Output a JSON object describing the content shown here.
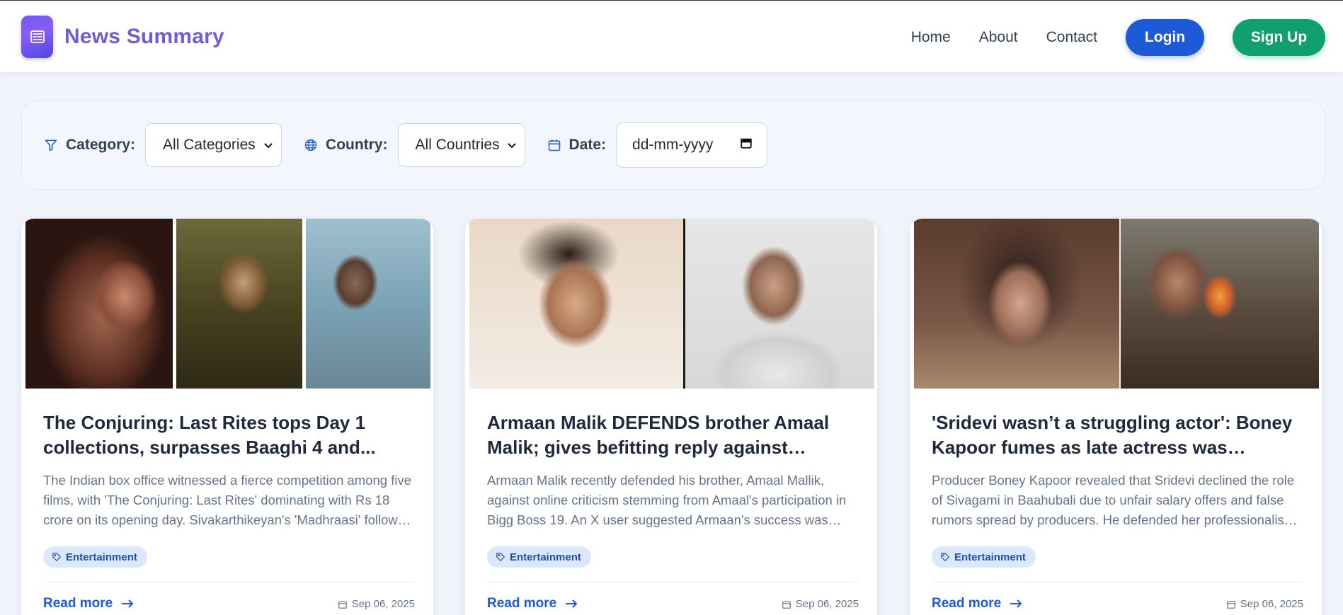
{
  "navbar": {
    "brand_name": "News Summary",
    "brand_icon": "newspaper-icon",
    "links": [
      "Home",
      "About",
      "Contact"
    ],
    "login_label": "Login",
    "signup_label": "Sign Up",
    "colors": {
      "brand": "#6b5fd6",
      "login": "#1d5ad8",
      "signup": "#10a06e"
    }
  },
  "filters": {
    "category_label": "Category:",
    "category_value": "All Categories",
    "country_label": "Country:",
    "country_value": "All Countries",
    "date_label": "Date:",
    "date_placeholder": "dd-mm-yyyy"
  },
  "cards": [
    {
      "title": "The Conjuring: Last Rites tops Day 1 collections, surpasses Baaghi 4 and...",
      "description": "The Indian box office witnessed a fierce competition among five films, with 'The Conjuring: Last Rites' dominating with Rs 18 crore on its opening day. Sivakarthikeyan's 'Madhraasi' followed with Rs...",
      "category": "Entertainment",
      "read_more": "Read more",
      "date": "Sep 06, 2025"
    },
    {
      "title": "Armaan Malik DEFENDS brother Amaal Malik; gives befitting reply against online...",
      "description": "Armaan Malik recently defended his brother, Amaal Mallik, against online criticism stemming from Amaal's participation in Bigg Boss 19. An X user suggested Armaan's success was solely due to...",
      "category": "Entertainment",
      "read_more": "Read more",
      "date": "Sep 06, 2025"
    },
    {
      "title": "'Sridevi wasn’t a struggling actor': Boney Kapoor fumes as late actress was offered...",
      "description": "Producer Boney Kapoor revealed that Sridevi declined the role of Sivagami in Baahubali due to unfair salary offers and false rumors spread by producers. He defended her professionalism, denied he...",
      "category": "Entertainment",
      "read_more": "Read more",
      "date": "Sep 06, 2025"
    }
  ]
}
